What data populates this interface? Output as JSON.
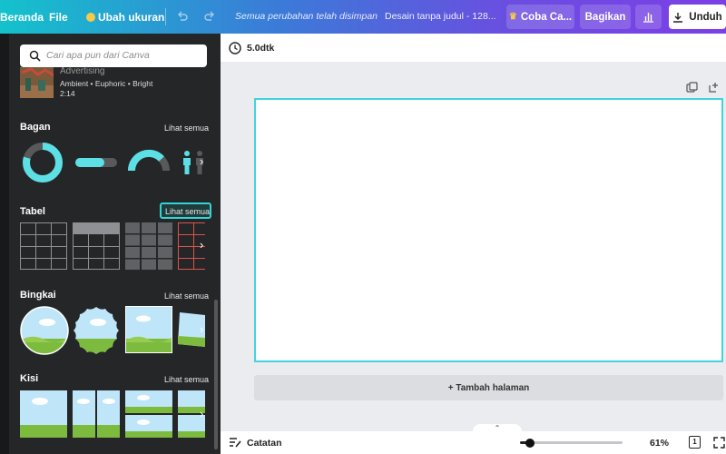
{
  "topbar": {
    "home_label": "Beranda",
    "file_label": "File",
    "resize_label": "Ubah ukuran",
    "save_status": "Semua perubahan telah disimpan",
    "doc_title": "Desain tanpa judul - 128...",
    "try_label": "Coba Ca...",
    "share_label": "Bagikan",
    "download_label": "Unduh"
  },
  "sidebar": {
    "search_placeholder": "Cari apa pun dari Canva",
    "audio": {
      "title": "Advertising",
      "tags": "Ambient • Euphoric • Bright",
      "duration": "2:14"
    },
    "sections": [
      {
        "title": "Bagan",
        "see_all": "Lihat semua"
      },
      {
        "title": "Tabel",
        "see_all": "Lihat semua"
      },
      {
        "title": "Bingkai",
        "see_all": "Lihat semua"
      },
      {
        "title": "Kisi",
        "see_all": "Lihat semua"
      }
    ]
  },
  "editor": {
    "duration_label": "5.0dtk",
    "add_page_label": "+ Tambah halaman",
    "notes_label": "Catatan",
    "zoom_label": "61%",
    "page_count": "1",
    "zoom_level": 0.61
  },
  "colors": {
    "accent": "#3fd5dc",
    "chart_teal": "#5ce0e6",
    "table_red": "#d9534f"
  }
}
